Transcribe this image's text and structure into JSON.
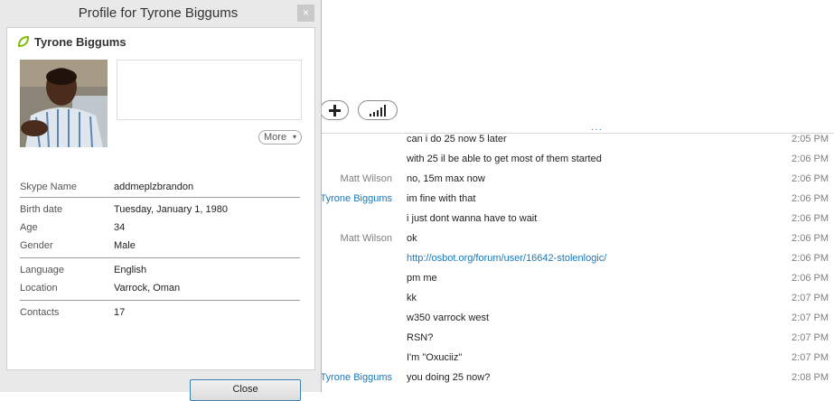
{
  "dialog": {
    "title": "Profile for Tyrone Biggums",
    "close_glyph": "×",
    "name": "Tyrone Biggums",
    "more_label": "More",
    "more_caret": "▾",
    "close_button_label": "Close",
    "fields": {
      "skype_name": {
        "label": "Skype Name",
        "value": "addmeplzbrandon"
      },
      "birth_date": {
        "label": "Birth date",
        "value": "Tuesday, January 1, 1980"
      },
      "age": {
        "label": "Age",
        "value": "34"
      },
      "gender": {
        "label": "Gender",
        "value": "Male"
      },
      "language": {
        "label": "Language",
        "value": "English"
      },
      "location": {
        "label": "Location",
        "value": "Varrock, Oman"
      },
      "contacts": {
        "label": "Contacts",
        "value": "17"
      }
    }
  },
  "chat": {
    "drag_handle": "···",
    "messages": [
      {
        "sender": "",
        "text": "can i do 25 now 5 later",
        "time": "2:05 PM"
      },
      {
        "sender": "",
        "text": "with 25 il be able to get most of them started",
        "time": "2:06 PM"
      },
      {
        "sender": "Matt Wilson",
        "text": "no, 15m max now",
        "time": "2:06 PM"
      },
      {
        "sender": "Tyrone Biggums",
        "text": "im fine with that",
        "time": "2:06 PM"
      },
      {
        "sender": "",
        "text": "i just dont wanna have to wait",
        "time": "2:06 PM"
      },
      {
        "sender": "Matt Wilson",
        "text": "ok",
        "time": "2:06 PM"
      },
      {
        "sender": "",
        "text": "http://osbot.org/forum/user/16642-stolenlogic/",
        "time": "2:06 PM"
      },
      {
        "sender": "",
        "text": "pm me",
        "time": "2:06 PM"
      },
      {
        "sender": "",
        "text": "kk",
        "time": "2:07 PM"
      },
      {
        "sender": "",
        "text": "w350 varrock west",
        "time": "2:07 PM"
      },
      {
        "sender": "",
        "text": "RSN?",
        "time": "2:07 PM"
      },
      {
        "sender": "",
        "text": "I'm \"Oxuciiz\"",
        "time": "2:07 PM"
      },
      {
        "sender": "Tyrone Biggums",
        "text": "you doing 25 now?",
        "time": "2:08 PM"
      }
    ]
  },
  "icons": {
    "status": "skype-online-leaf-icon",
    "add": "plus-icon",
    "signal": "call-quality-bars-icon"
  },
  "colors": {
    "link": "#1a77b8",
    "status_green": "#7fba00",
    "dialog_bg": "#e9e9e9"
  }
}
